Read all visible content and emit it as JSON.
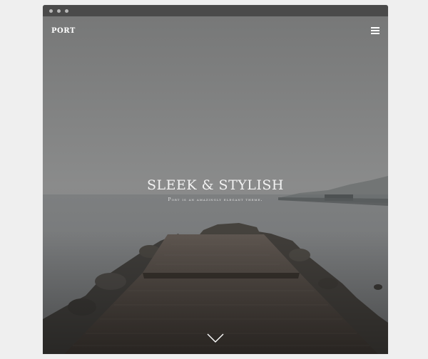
{
  "site": {
    "logo": "PORT"
  },
  "hero": {
    "title": "SLEEK & STYLISH",
    "subtitle": "Port is an amazingly elegant theme."
  },
  "icons": {
    "menu": "hamburger-menu-icon",
    "scroll": "chevron-down-icon"
  },
  "colors": {
    "page_background": "#efefef",
    "browser_bar": "#4a4a4a",
    "hero_text": "#f2f2f2"
  }
}
